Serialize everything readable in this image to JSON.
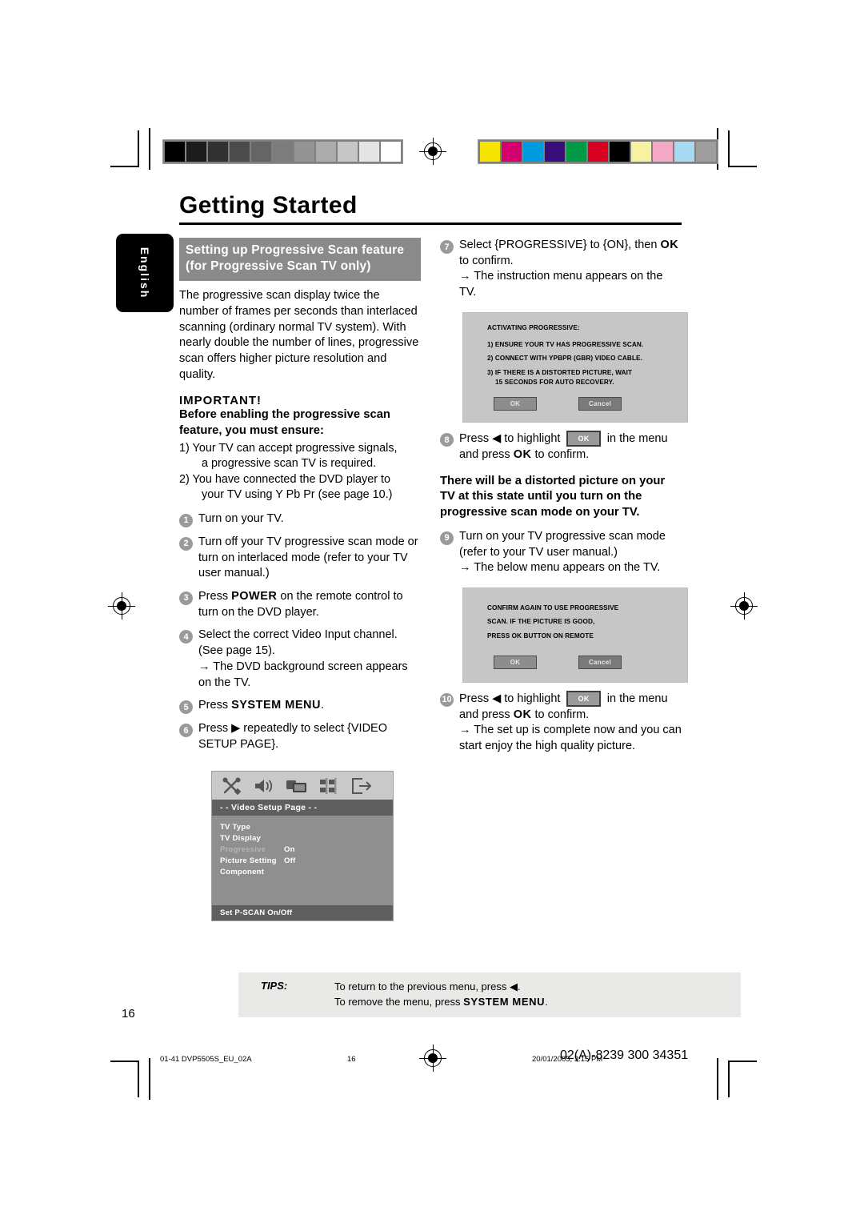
{
  "header": {
    "title": "Getting Started",
    "language_tab": "English"
  },
  "left_column": {
    "section_heading_line1": "Setting up Progressive Scan feature",
    "section_heading_line2": "(for Progressive Scan TV only)",
    "intro": "The progressive scan display twice the number of frames per seconds than interlaced scanning (ordinary normal TV system). With nearly double the number of lines, progressive scan offers higher picture resolution and quality.",
    "important_label": "IMPORTANT!",
    "important_text": "Before enabling the progressive scan feature, you must ensure:",
    "requirements": [
      {
        "num": "1)",
        "text": "Your TV can accept progressive signals,",
        "cont": "a progressive scan TV is required."
      },
      {
        "num": "2)",
        "text": "You have connected the DVD player to",
        "cont": "your TV using Y Pb Pr (see page 10.)"
      }
    ],
    "steps": [
      {
        "num": "1",
        "text": "Turn on your TV."
      },
      {
        "num": "2",
        "text": "Turn off your TV progressive scan mode or turn on interlaced mode (refer to your TV user manual.)"
      },
      {
        "num": "3",
        "pre": "Press ",
        "bold": "POWER",
        "post": " on the remote control to turn on the DVD player."
      },
      {
        "num": "4",
        "text": "Select the correct Video Input channel. (See page 15).",
        "arrow": "→ The DVD background screen appears on the TV."
      },
      {
        "num": "5",
        "pre": "Press ",
        "bold": "SYSTEM MENU",
        "post": "."
      },
      {
        "num": "6",
        "text": "Press ▶ repeatedly to select {VIDEO SETUP PAGE}."
      }
    ]
  },
  "osd_menu": {
    "icons": [
      "tools-icon",
      "speaker-icon",
      "video-icon",
      "preferences-icon",
      "exit-icon"
    ],
    "title": "- -  Video Setup Page  - -",
    "rows": [
      {
        "key": "TV Type",
        "value": "",
        "dim": false
      },
      {
        "key": "TV Display",
        "value": "",
        "dim": false
      },
      {
        "key": "Progressive",
        "value": "On",
        "dim": true
      },
      {
        "key": "Picture Setting",
        "value": "Off",
        "dim": false
      },
      {
        "key": "Component",
        "value": "",
        "dim": false
      }
    ],
    "footer": "Set P-SCAN On/Off"
  },
  "right_column": {
    "steps": [
      {
        "num": "7",
        "pre": "Select {PROGRESSIVE} to {ON}, then ",
        "bold": "OK",
        "post": " to confirm.",
        "arrow": "→ The instruction menu appears on the TV."
      },
      {
        "num": "8",
        "pre": "Press ◀ to highlight ",
        "chip": "OK",
        "mid": " in the menu and press ",
        "bold": "OK",
        "post": " to confirm."
      },
      {
        "num": "9",
        "text": "Turn on your TV progressive scan mode (refer to your TV user manual.)",
        "arrow": "→ The below menu appears on the TV."
      },
      {
        "num": "10",
        "pre": "Press ◀ to highlight ",
        "chip": "OK",
        "mid": " in the menu and press ",
        "bold": "OK",
        "post": " to confirm.",
        "arrow": "→ The set up is complete now and you can start enjoy the high quality picture."
      }
    ],
    "warning": "There will be a distorted picture on your TV at this state until you turn on the progressive scan mode on your TV."
  },
  "dialog_activating": {
    "heading": "ACTIVATING PROGRESSIVE:",
    "lines": [
      "1) ENSURE YOUR TV HAS PROGRESSIVE SCAN.",
      "2) CONNECT WITH YPBPR (GBR) VIDEO CABLE.",
      "3) IF THERE IS A DISTORTED PICTURE, WAIT"
    ],
    "line_indent": "15 SECONDS FOR AUTO RECOVERY.",
    "ok_label": "OK",
    "cancel_label": "Cancel"
  },
  "dialog_confirm": {
    "lines": [
      "CONFIRM AGAIN TO USE PROGRESSIVE",
      "SCAN.  IF THE PICTURE IS GOOD,",
      "PRESS OK BUTTON ON REMOTE"
    ],
    "ok_label": "OK",
    "cancel_label": "Cancel"
  },
  "tips": {
    "label": "TIPS:",
    "line1": "To return to the previous menu, press ◀.",
    "line2_pre": "To remove the menu, press ",
    "line2_bold": "SYSTEM MENU",
    "line2_post": "."
  },
  "page_number": "16",
  "footer": {
    "left": "01-41 DVP5505S_EU_02A",
    "center": "16",
    "timestamp": "20/01/2005, 3:15 PM",
    "code": "02(A)-8239 300 34351"
  },
  "color_bars": {
    "grayscale": [
      "#000000",
      "#1c1c1c",
      "#323232",
      "#4b4b4b",
      "#656565",
      "#7c7c7c",
      "#949494",
      "#ababab",
      "#c6c6c6",
      "#e4e4e4",
      "#ffffff"
    ],
    "colors": [
      "#f5e400",
      "#d4006e",
      "#009ade",
      "#3a0d7d",
      "#009a47",
      "#d70021",
      "#000000",
      "#f7f2a0",
      "#f5a8c5",
      "#a7d9f3",
      "#9e9e9e"
    ]
  }
}
